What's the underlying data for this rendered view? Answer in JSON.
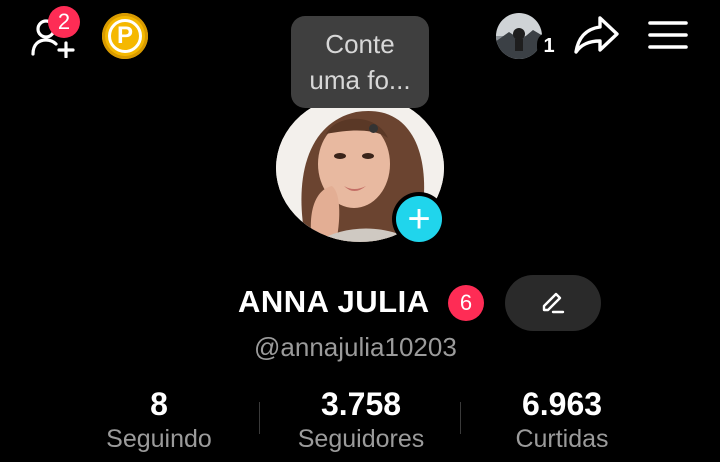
{
  "topbar": {
    "add_friends_badge": "2",
    "coin_letter": "P",
    "account_switch_count": "1"
  },
  "tooltip": {
    "line1": "Conte",
    "line2": "uma fo..."
  },
  "profile": {
    "name": "ANNA JULIA",
    "notification_badge": "6",
    "handle": "@annajulia10203"
  },
  "stats": [
    {
      "value": "8",
      "label": "Seguindo"
    },
    {
      "value": "3.758",
      "label": "Seguidores"
    },
    {
      "value": "6.963",
      "label": "Curtidas"
    }
  ],
  "colors": {
    "background": "#000000",
    "badge_red": "#fe2c55",
    "add_avatar_cyan": "#20d5ec",
    "coin_gold": "#f5b800",
    "muted_text": "#9b9b9b"
  },
  "icons": [
    "add-friend-icon",
    "coin-icon",
    "account-avatar-icon",
    "share-icon",
    "menu-icon",
    "plus-icon",
    "pencil-icon"
  ]
}
